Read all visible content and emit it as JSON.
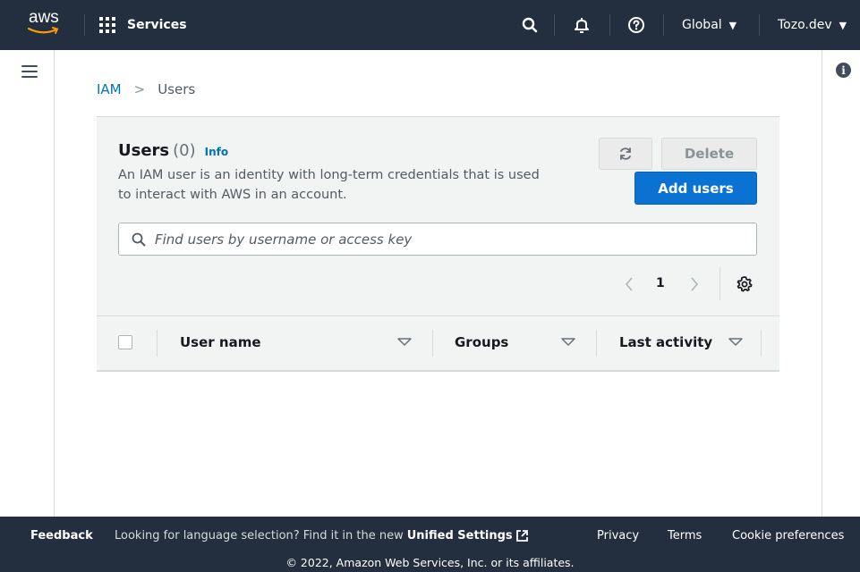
{
  "topnav": {
    "logo_text": "aws",
    "services_label": "Services",
    "region_label": "Global",
    "account_label": "Tozo.dev",
    "icons": [
      "search-icon",
      "bell-icon",
      "help-icon"
    ]
  },
  "breadcrumb": {
    "root": "IAM",
    "separator": ">",
    "current": "Users"
  },
  "panel": {
    "title": "Users",
    "count": "(0)",
    "info_link": "Info",
    "description": "An IAM user is an identity with long-term credentials that is used to interact with AWS in an account.",
    "delete_label": "Delete",
    "add_label": "Add users",
    "search_placeholder": "Find users by username or access key",
    "page_number": "1"
  },
  "table": {
    "columns": [
      "User name",
      "Groups",
      "Last activity"
    ]
  },
  "footer": {
    "feedback": "Feedback",
    "language_prompt": "Looking for language selection? Find it in the new",
    "unified_settings": "Unified Settings",
    "privacy": "Privacy",
    "terms": "Terms",
    "cookies": "Cookie preferences",
    "copyright": "© 2022, Amazon Web Services, Inc. or its affiliates."
  },
  "colors": {
    "nav_bg": "#232f3e",
    "primary_button": "#0972d3",
    "link": "#0073bb",
    "panel_bg": "#f2f3f3"
  }
}
